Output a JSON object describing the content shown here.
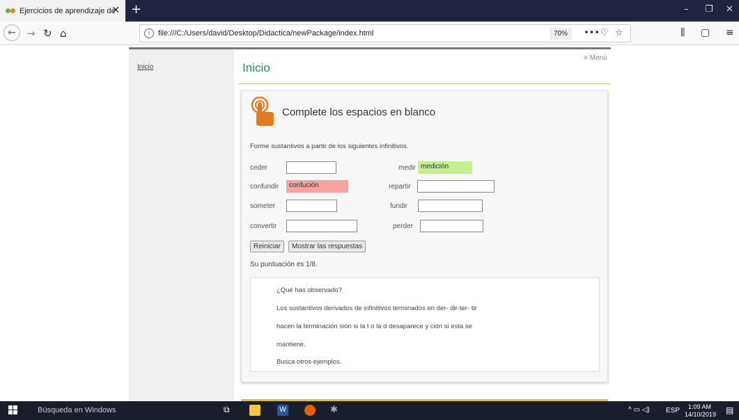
{
  "browser": {
    "tab_title": "Ejercicios de aprendizaje de Esp",
    "url": "file:///C:/Users/david/Desktop/Didactica/newPackage/index.html",
    "zoom": "70%"
  },
  "sidebar": {
    "link": "Inicio"
  },
  "header": {
    "menu": "≡ Menú",
    "title": "Inicio"
  },
  "exercise": {
    "title": "Complete los espacios en blanco",
    "instruction": "Forme sustantivos a partir de los siguientes infinitivos.",
    "fields": [
      {
        "label": "ceder",
        "value": ""
      },
      {
        "label": "medir",
        "value": "medición"
      },
      {
        "label": "confundir",
        "value": "confución"
      },
      {
        "label": "repartir",
        "value": ""
      },
      {
        "label": "someter",
        "value": ""
      },
      {
        "label": "fundir",
        "value": ""
      },
      {
        "label": "convertir",
        "value": ""
      },
      {
        "label": "perder",
        "value": ""
      }
    ],
    "reset_label": "Reiniciar",
    "show_label": "Mostrar las respuestas",
    "score": "Su puntuación es 1/8."
  },
  "feedback": {
    "lines": [
      "¿Qué has observado?",
      "Los sustantivos derivados de infinitivos terminados en der- dir-ter- tir",
      "hacen la terminación sión si la t o la d desaparece y ción si esta se",
      "mantiene.",
      "Busca otros ejemplos."
    ]
  },
  "taskbar": {
    "search_placeholder": "Búsqueda en Windows",
    "lang": "ESP",
    "time": "1:09 AM",
    "date": "14/10/2019"
  },
  "colors": {
    "accent_green": "#2c8a64",
    "correct_bg": "#c5ef95",
    "wrong_bg": "#f5a3a3",
    "rule": "#d9b673",
    "hand_icon": "#e07b22"
  }
}
